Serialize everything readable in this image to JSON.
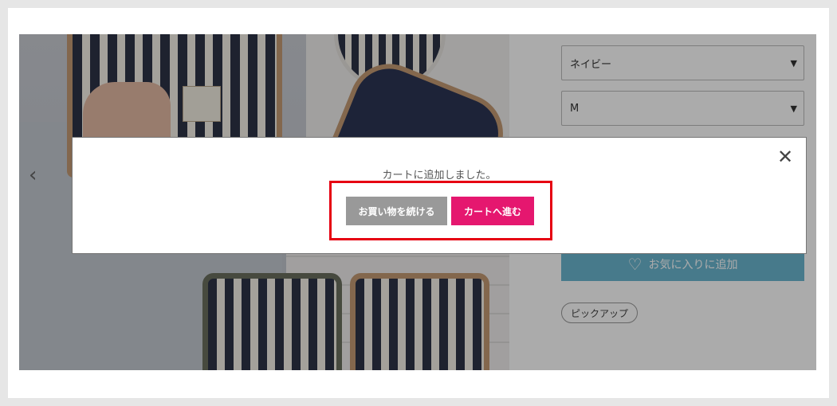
{
  "product": {
    "color_select": {
      "value": "ネイビー"
    },
    "size_select": {
      "value": "M"
    },
    "favorite_button": {
      "label": "お気に入りに追加",
      "icon": "heart-outline-icon"
    },
    "tag": {
      "label": "ピックアップ"
    }
  },
  "modal": {
    "message": "カートに追加しました。",
    "continue_label": "お買い物を続ける",
    "cart_label": "カートへ進む",
    "close_icon": "close-icon"
  },
  "colors": {
    "cart_button": "#e5176f",
    "continue_button": "#999999",
    "highlight_border": "#e60012",
    "favorite_button": "#6bb7cf"
  }
}
